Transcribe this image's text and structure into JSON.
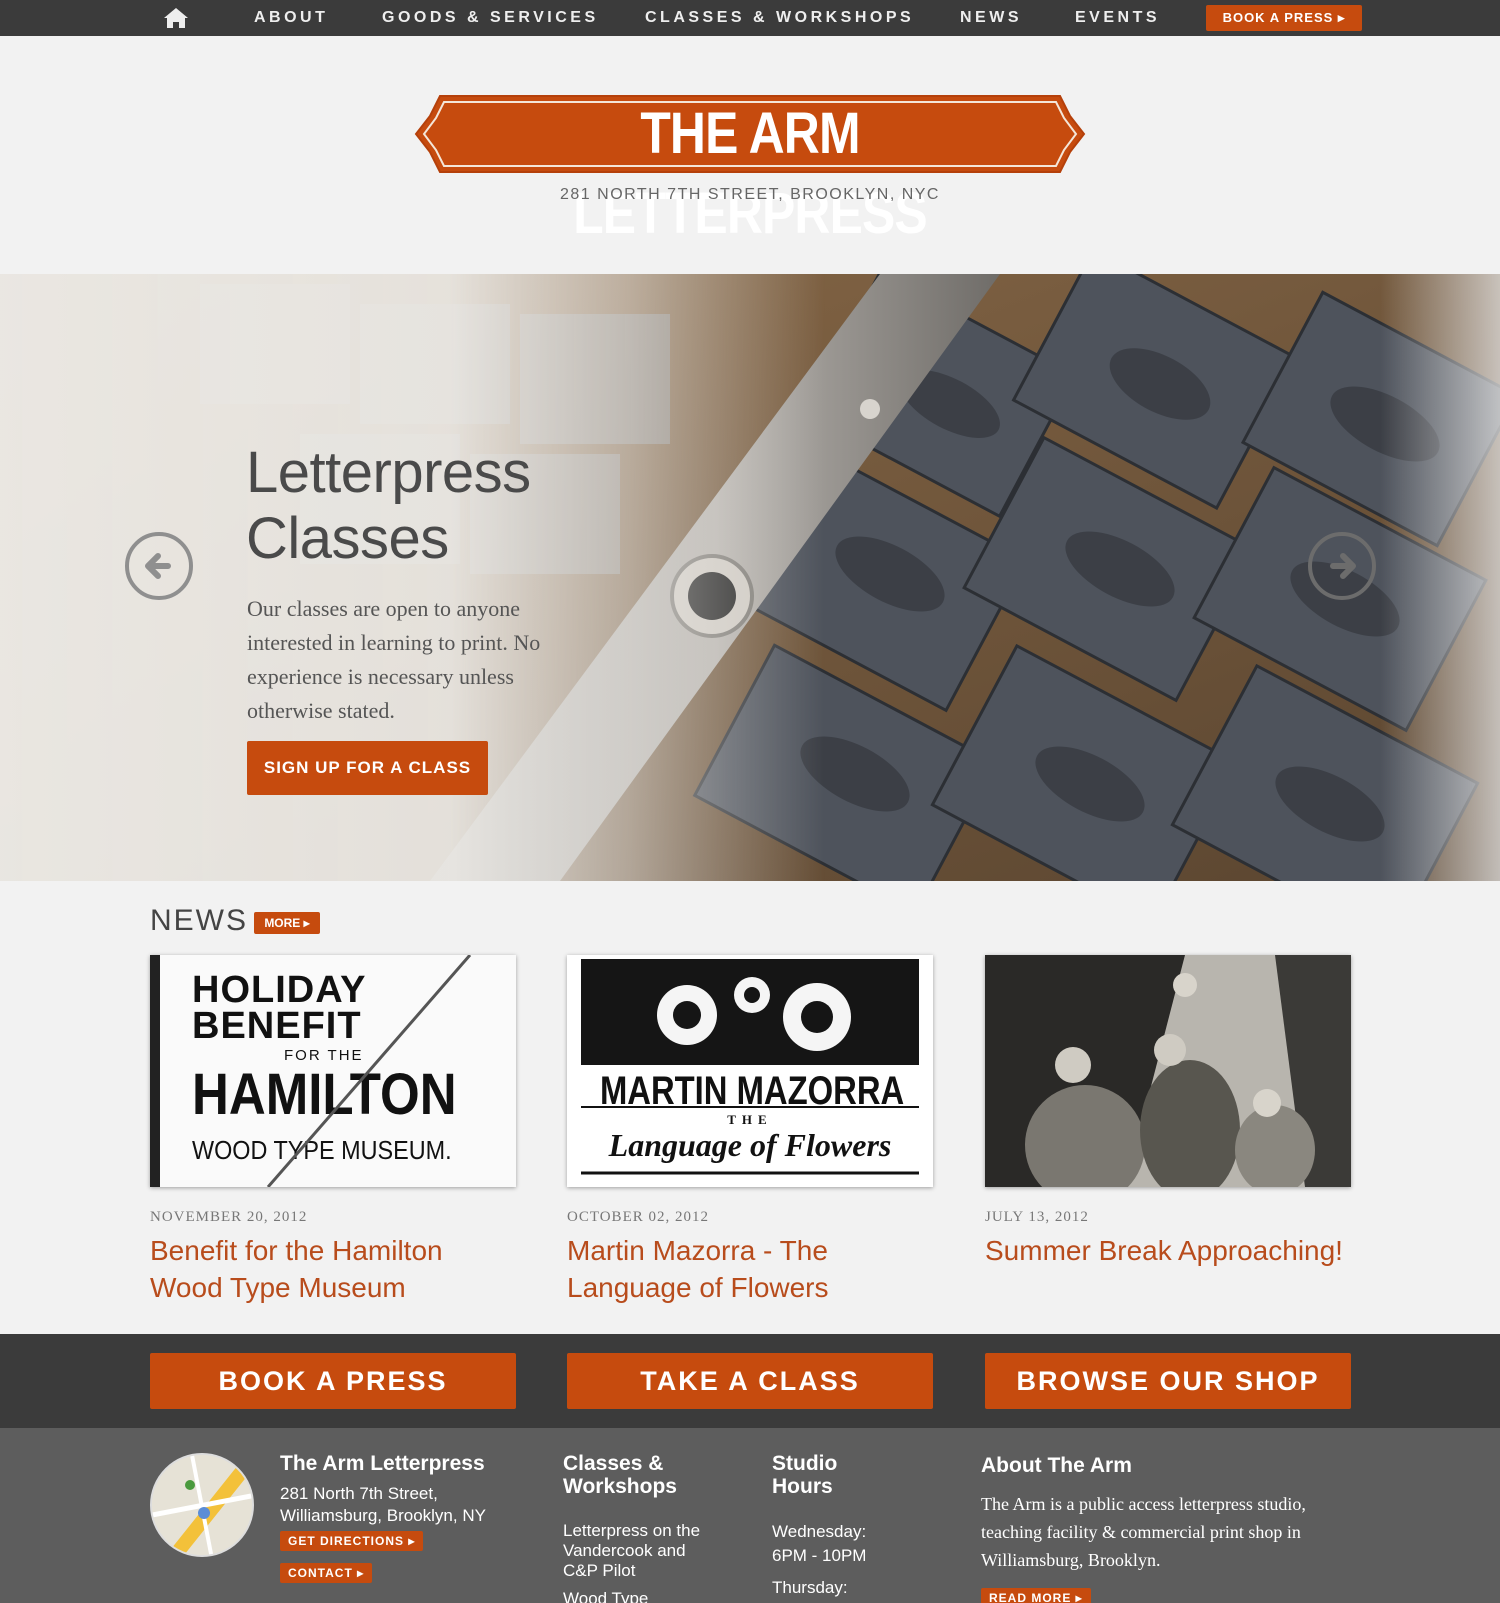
{
  "nav": {
    "home_icon": "home-icon",
    "items": [
      "ABOUT",
      "GOODS & SERVICES",
      "CLASSES & WORKSHOPS",
      "NEWS",
      "EVENTS"
    ],
    "book_label": "BOOK A PRESS ▸"
  },
  "header": {
    "logo_text": "THE ARM LETTERPRESS",
    "address": "281 NORTH 7TH STREET, BROOKLYN, NYC"
  },
  "hero": {
    "title": "Letterpress Classes",
    "text": "Our classes are open to anyone interested in learning to print. No experience is necessary unless otherwise stated.",
    "button": "SIGN UP FOR A CLASS",
    "prev_icon": "arrow-left-icon",
    "next_icon": "arrow-right-icon"
  },
  "news": {
    "heading": "NEWS",
    "more_label": "MORE ▸",
    "items": [
      {
        "date": "NOVEMBER 20, 2012",
        "title": "Benefit for the Hamilton Wood Type Museum",
        "poster": {
          "line1": "HOLIDAY",
          "line2": "BENEFIT",
          "line3": "FOR THE",
          "line4": "HAMILTON",
          "line5": "WOOD TYPE MUSEUM."
        }
      },
      {
        "date": "OCTOBER 02, 2012",
        "title": "Martin Mazorra - The Language of Flowers",
        "poster": {
          "line1": "MARTIN MAZORRA",
          "line2": "THE",
          "line3": "Language of Flowers"
        }
      },
      {
        "date": "JULY 13, 2012",
        "title": "Summer Break Approaching!"
      }
    ]
  },
  "cta": {
    "book": "BOOK A PRESS",
    "class": "TAKE A CLASS",
    "shop": "BROWSE OUR SHOP"
  },
  "footer": {
    "studio_name": "The Arm Letterpress",
    "address_line1": "281 North 7th Street,",
    "address_line2": "Williamsburg, Brooklyn, NY",
    "directions_label": "GET DIRECTIONS ▸",
    "contact_label": "CONTACT ▸",
    "classes_heading": "Classes & Workshops",
    "classes_link": "Letterpress on the Vandercook and C&P Pilot",
    "classes_link2": "Wood Type",
    "hours_heading": "Studio Hours",
    "hours_day1": "Wednesday:",
    "hours_time1": "6PM - 10PM",
    "hours_day2": "Thursday:",
    "about_heading": "About The Arm",
    "about_text": "The Arm is a public access letterpress studio, teaching facility & commercial print shop in Williamsburg, Brooklyn.",
    "read_more_label": "READ MORE ▸"
  },
  "colors": {
    "accent": "#c64b0e",
    "nav_bg": "#3b3b3b",
    "footer_bg": "#5d5d5d",
    "link": "#b84c1c"
  }
}
